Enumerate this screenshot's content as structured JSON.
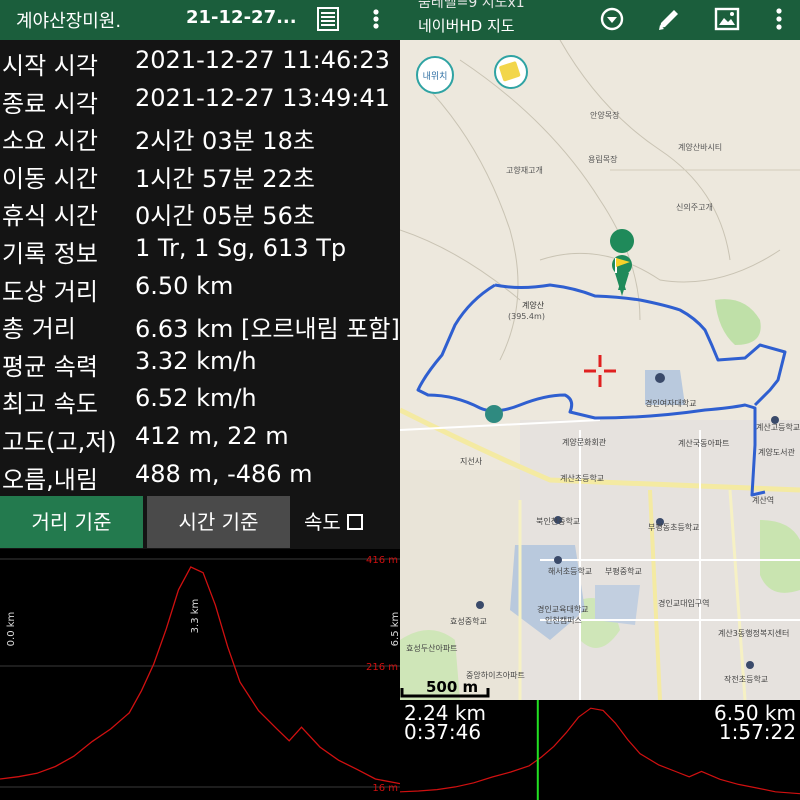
{
  "left_header": {
    "title": "계야산장미원.",
    "date": "21-12-27..."
  },
  "stats": [
    {
      "label": "시작 시각",
      "value": "2021-12-27 11:46:23"
    },
    {
      "label": "종료 시각",
      "value": "2021-12-27 13:49:41"
    },
    {
      "label": "소요 시간",
      "value": "2시간 03분 18초"
    },
    {
      "label": "이동 시간",
      "value": "1시간 57분 22초"
    },
    {
      "label": "휴식 시간",
      "value": "0시간 05분 56초"
    },
    {
      "label": "기록 정보",
      "value": "1 Tr, 1 Sg, 613 Tp"
    },
    {
      "label": "도상 거리",
      "value": "6.50 km"
    },
    {
      "label": "총 거리",
      "value": "6.63 km [오르내림 포함]"
    },
    {
      "label": "평균 속력",
      "value": "3.32 km/h"
    },
    {
      "label": "최고 속도",
      "value": "6.52 km/h"
    },
    {
      "label": "고도(고,저)",
      "value": "412 m, 22 m"
    },
    {
      "label": "오름,내림",
      "value": "488 m, -486 m"
    }
  ],
  "buttons": {
    "distance": "거리 기준",
    "time": "시간 기준",
    "speed": "속도"
  },
  "elevation_chart": {
    "y_max_label": "416 m",
    "y_mid_label": "216 m",
    "y_min_label": "16 m",
    "x_start_label": "0.0 km",
    "x_mid_label": "3.3 km",
    "x_end_label": "6.5 km",
    "line_color": "#d01010"
  },
  "chart_data": {
    "type": "line",
    "x": [
      0.0,
      0.3,
      0.6,
      0.9,
      1.2,
      1.5,
      1.8,
      2.1,
      2.3,
      2.5,
      2.7,
      2.9,
      3.1,
      3.3,
      3.5,
      3.7,
      3.9,
      4.2,
      4.5,
      4.7,
      4.9,
      5.2,
      5.5,
      5.8,
      6.1,
      6.5
    ],
    "values": [
      30,
      34,
      40,
      52,
      70,
      96,
      118,
      146,
      185,
      232,
      293,
      362,
      402,
      392,
      335,
      262,
      200,
      150,
      118,
      97,
      121,
      86,
      63,
      47,
      30,
      22
    ],
    "xlabel": "",
    "ylabel": "",
    "ylim": [
      16,
      416
    ],
    "xlim": [
      0.0,
      6.5
    ]
  },
  "right_header": {
    "zoom_text": "줌레벨=9 지도x1",
    "map_source": "네이버HD 지도"
  },
  "map": {
    "route_color": "#2f5fd0",
    "labels": [
      "계양산",
      "(395.4m)",
      "계양문화회관",
      "계산초등학교",
      "북인천중학교",
      "해서초등학교",
      "부평중학교",
      "경인교육대학교",
      "인천캠퍼스",
      "효성중학교",
      "효성두산아파트",
      "부평동초등학교",
      "경인교대입구역",
      "계산국동아파트",
      "경인여자대학교",
      "계양도서관",
      "계산고등학교",
      "계산역",
      "고향재고개",
      "안양목장",
      "용림목장",
      "계양산바시티",
      "신의주고개",
      "지선사",
      "중앙하이츠아파트",
      "작전초등학교",
      "계산3동행정복지센터"
    ],
    "scale_label": "500 m",
    "inner_button": "내위치"
  },
  "mini_chart": {
    "dist_left": "2.24 km",
    "time_left": "0:37:46",
    "dist_right": "6.50 km",
    "time_right": "1:57:22"
  }
}
